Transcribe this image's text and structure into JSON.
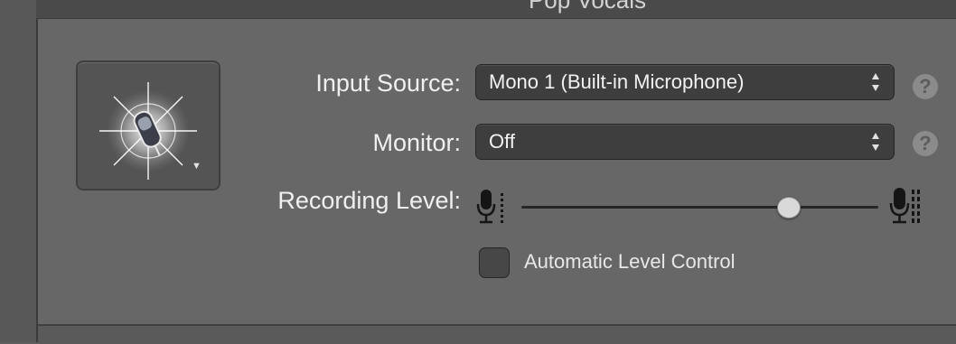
{
  "header": {
    "track_name": "Pop Vocals"
  },
  "patch": {
    "icon": "microphone-burst-icon"
  },
  "input_source": {
    "label": "Input Source:",
    "value": "Mono 1 (Built-in Microphone)",
    "help": "?"
  },
  "monitor": {
    "label": "Monitor:",
    "value": "Off",
    "help": "?"
  },
  "recording_level": {
    "label": "Recording Level:",
    "level": 0.75
  },
  "auto_level": {
    "label": "Automatic Level Control",
    "checked": false
  }
}
